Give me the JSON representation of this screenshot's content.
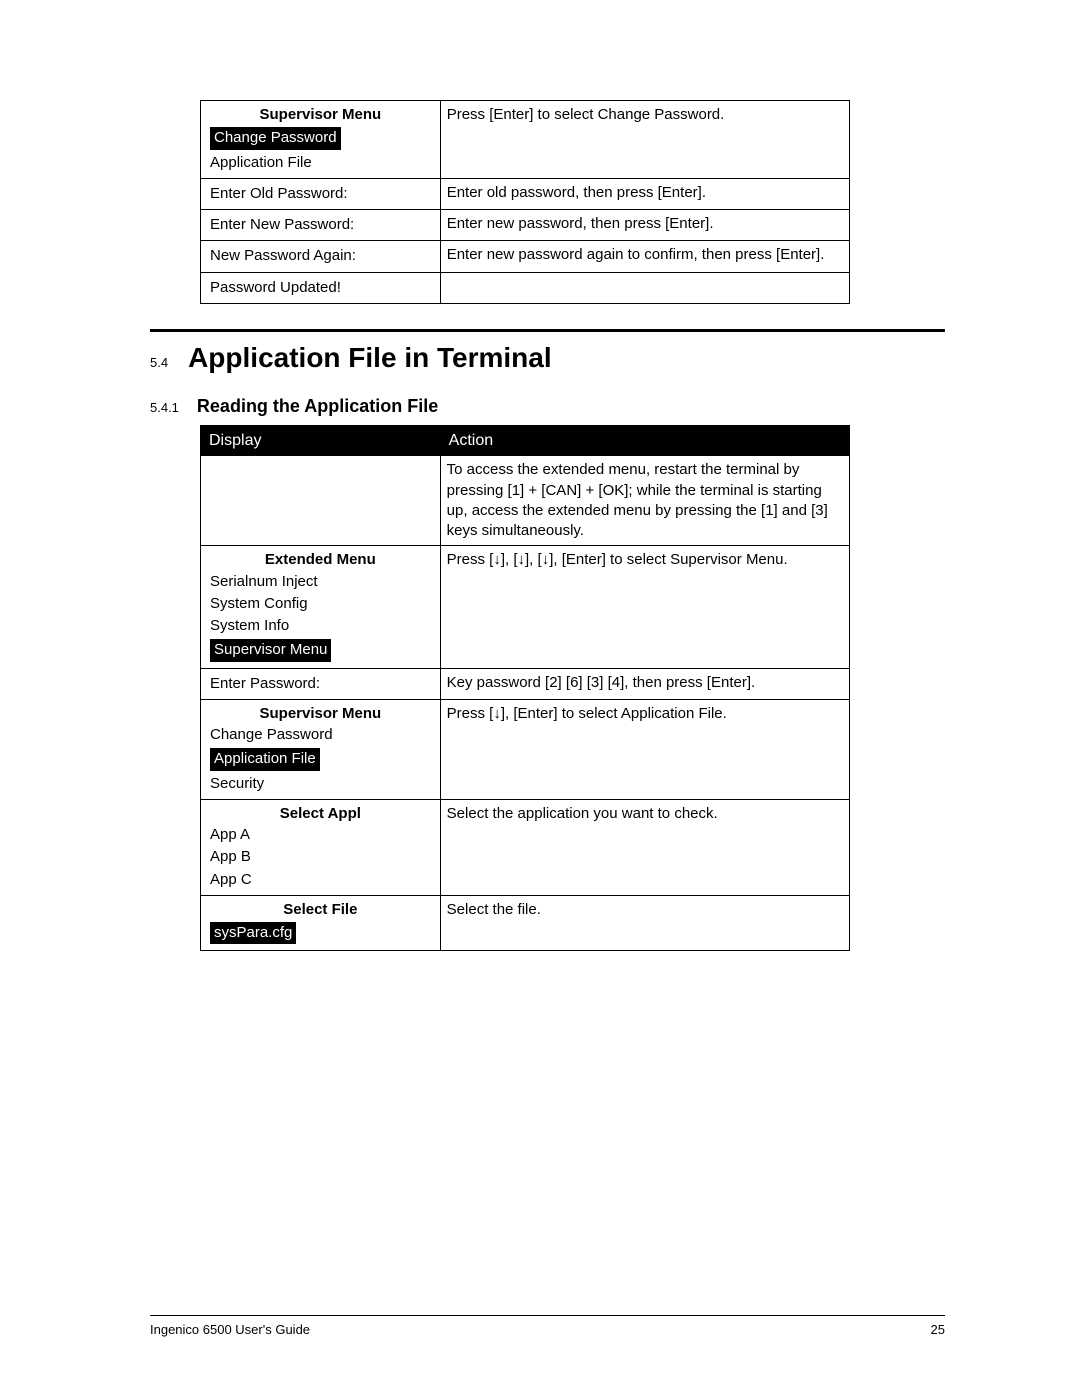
{
  "table1": {
    "rows": [
      {
        "display": {
          "title": "Supervisor Menu",
          "lines": [
            {
              "text": "Change Password",
              "hl": true
            },
            {
              "text": "Application File",
              "hl": false
            }
          ]
        },
        "action": "Press [Enter] to select Change Password."
      },
      {
        "display": {
          "lines": [
            {
              "text": "Enter Old Password:",
              "hl": false
            }
          ]
        },
        "action": "Enter old password, then press [Enter]."
      },
      {
        "display": {
          "lines": [
            {
              "text": "Enter New Password:",
              "hl": false
            }
          ]
        },
        "action": "Enter new password, then press [Enter]."
      },
      {
        "display": {
          "lines": [
            {
              "text": "New Password Again:",
              "hl": false
            }
          ]
        },
        "action": "Enter new password again to confirm, then press [Enter]."
      },
      {
        "display": {
          "lines": [
            {
              "text": "Password Updated!",
              "hl": false
            }
          ]
        },
        "action": ""
      }
    ]
  },
  "section": {
    "num": "5.4",
    "title": "Application File in Terminal"
  },
  "subsection": {
    "num": "5.4.1",
    "title": "Reading the Application File"
  },
  "table2": {
    "header": {
      "display": "Display",
      "action": "Action"
    },
    "rows": [
      {
        "display": {
          "lines": []
        },
        "action": "To access the extended menu, restart the terminal by pressing [1] + [CAN] + [OK]; while the terminal is starting up, access the extended menu by pressing the [1] and [3] keys simultaneously."
      },
      {
        "display": {
          "title": "Extended Menu",
          "lines": [
            {
              "text": "Serialnum Inject",
              "hl": false
            },
            {
              "text": "System Config",
              "hl": false
            },
            {
              "text": "System Info",
              "hl": false
            },
            {
              "text": "Supervisor Menu",
              "hl": true
            }
          ]
        },
        "action": "Press [↓], [↓], [↓], [Enter] to select Supervisor Menu."
      },
      {
        "display": {
          "lines": [
            {
              "text": "Enter Password:",
              "hl": false
            }
          ]
        },
        "action": "Key password [2] [6] [3] [4], then press [Enter]."
      },
      {
        "display": {
          "title": "Supervisor Menu",
          "lines": [
            {
              "text": "Change Password",
              "hl": false
            },
            {
              "text": "Application File",
              "hl": true
            },
            {
              "text": "Security",
              "hl": false
            }
          ]
        },
        "action": "Press [↓], [Enter] to select Application File."
      },
      {
        "display": {
          "title": "Select Appl",
          "lines": [
            {
              "text": "App A",
              "hl": false
            },
            {
              "text": "App B",
              "hl": false
            },
            {
              "text": "App C",
              "hl": false
            }
          ]
        },
        "action": "Select the application you want to check."
      },
      {
        "display": {
          "title": "Select File",
          "lines": [
            {
              "text": "sysPara.cfg",
              "hl": true
            }
          ]
        },
        "action": "Select the file."
      }
    ]
  },
  "footer": {
    "left": "Ingenico 6500 User's Guide",
    "right": "25"
  }
}
